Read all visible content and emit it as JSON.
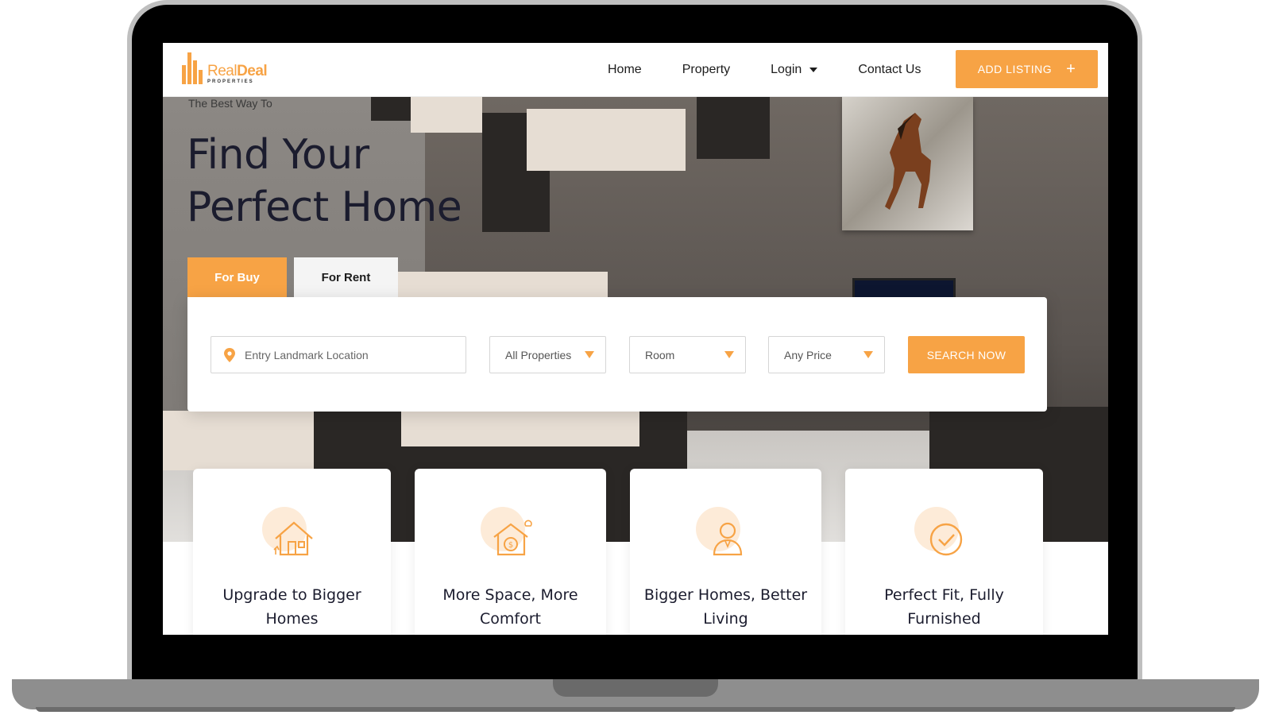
{
  "brand": {
    "logo_word_a": "Real",
    "logo_word_b": "Deal",
    "logo_sub": "PROPERTIES",
    "accent_color": "#f7a345",
    "text_color": "#1b1c2e"
  },
  "nav": {
    "links": [
      "Home",
      "Property",
      "Login",
      "Contact Us"
    ],
    "add_listing_label": "ADD LISTING",
    "add_listing_icon": "plus-icon",
    "login_icon": "caret-down-icon"
  },
  "hero": {
    "subtitle": "The Best Way To",
    "title_line1": "Find Your",
    "title_line2": "Perfect Home"
  },
  "tabs": {
    "buy": "For Buy",
    "rent": "For Rent",
    "active": "For Buy"
  },
  "search": {
    "location_placeholder": "Entry Landmark Location",
    "location_icon": "map-pin-icon",
    "property_type": "All Properties",
    "room": "Room",
    "price": "Any Price",
    "dropdown_icon": "triangle-down-icon",
    "button_label": "SEARCH NOW"
  },
  "features": [
    {
      "title": "Upgrade to Bigger Homes",
      "icon": "house-icon"
    },
    {
      "title": "More Space, More Comfort",
      "icon": "house-money-icon"
    },
    {
      "title": "Bigger Homes, Better Living",
      "icon": "agent-icon"
    },
    {
      "title": "Perfect Fit, Fully Furnished",
      "icon": "check-circle-icon"
    }
  ]
}
